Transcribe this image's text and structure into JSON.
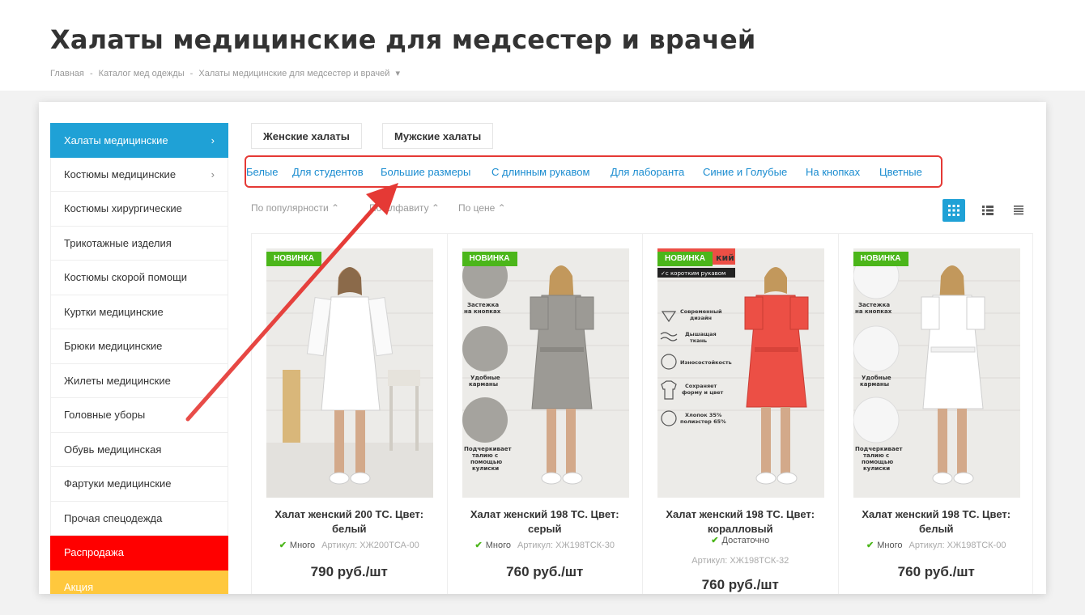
{
  "page": {
    "title": "Халаты медицинские для медсестер и врачей",
    "breadcrumb": [
      "Главная",
      "-",
      "Каталог мед одежды",
      "-",
      "Халаты медицинские для медсестер и врачей",
      "▾"
    ]
  },
  "sidebar": {
    "items": [
      {
        "label": "Халаты медицинские",
        "chevron": "›"
      },
      {
        "label": "Костюмы медицинские",
        "chevron": "›"
      },
      {
        "label": "Костюмы хирургические"
      },
      {
        "label": "Трикотажные изделия"
      },
      {
        "label": "Костюмы скорой помощи"
      },
      {
        "label": "Куртки медицинские"
      },
      {
        "label": "Брюки медицинские"
      },
      {
        "label": "Жилеты медицинские"
      },
      {
        "label": "Головные уборы"
      },
      {
        "label": "Обувь медицинская"
      },
      {
        "label": "Фартуки медицинские"
      },
      {
        "label": "Прочая спецодежда"
      },
      {
        "label": "Распродажа"
      },
      {
        "label": "Акция"
      }
    ],
    "colors": {
      "active": "#1fa1d6",
      "sale": "#ff0000",
      "promo": "#ffc83d"
    }
  },
  "type_tabs": [
    "Женские халаты",
    "Мужские халаты"
  ],
  "subcategories": [
    "Белые",
    "Для студентов",
    "Большие размеры",
    "С длинным рукавом",
    "Для лаборанта",
    "Синие и Голубые",
    "На кнопках",
    "Цветные"
  ],
  "sort": {
    "items": [
      "По популярности ⌃",
      "По алфавиту ⌃",
      "По цене ⌃"
    ],
    "views": [
      "grid-view-icon",
      "list-view-icon",
      "table-view-icon"
    ],
    "active_view": "grid-view-icon"
  },
  "products": [
    {
      "badge": "НОВИНКА",
      "name": "Халат женский 200 ТС. Цвет: белый",
      "stock": "Много",
      "sku": "Артикул: ХЖ200ТСА-00",
      "price": "790 руб./шт",
      "color": "#ffffff"
    },
    {
      "badge": "НОВИНКА",
      "name": "Халат женский 198 ТС. Цвет: серый",
      "stock": "Много",
      "sku": "Артикул: ХЖ198ТСК-30",
      "price": "760 руб./шт",
      "color": "#9c9a95",
      "features": [
        "Застежка на кнопках",
        "Удобные карманы",
        "Подчеркивает талию с помощью кулиски"
      ]
    },
    {
      "badge": "НОВИНКА",
      "name": "Халат женский 198 ТС. Цвет: коралловый",
      "stock": "Достаточно",
      "sku": "Артикул: ХЖ198ТСК-32",
      "price": "760 руб./шт",
      "color": "#ec4f45",
      "features": [
        "Современный дизайн",
        "Дышащая ткань",
        "Износостойкость",
        "Сохраняет форму и цвет",
        "Хлопок 35% полиэстер 65%"
      ],
      "overlay": "с коротким рукавом",
      "overlay_top": "кий"
    },
    {
      "badge": "НОВИНКА",
      "name": "Халат женский 198 ТС. Цвет: белый",
      "stock": "Много",
      "sku": "Артикул: ХЖ198ТСК-00",
      "price": "760 руб./шт",
      "color": "#ffffff",
      "features": [
        "Застежка на кнопках",
        "Удобные карманы",
        "Подчеркивает талию с помощью кулиски"
      ]
    }
  ],
  "accent_color": "#1a8cd0",
  "highlight_color": "#e53935",
  "badge_color": "#4bb61a"
}
